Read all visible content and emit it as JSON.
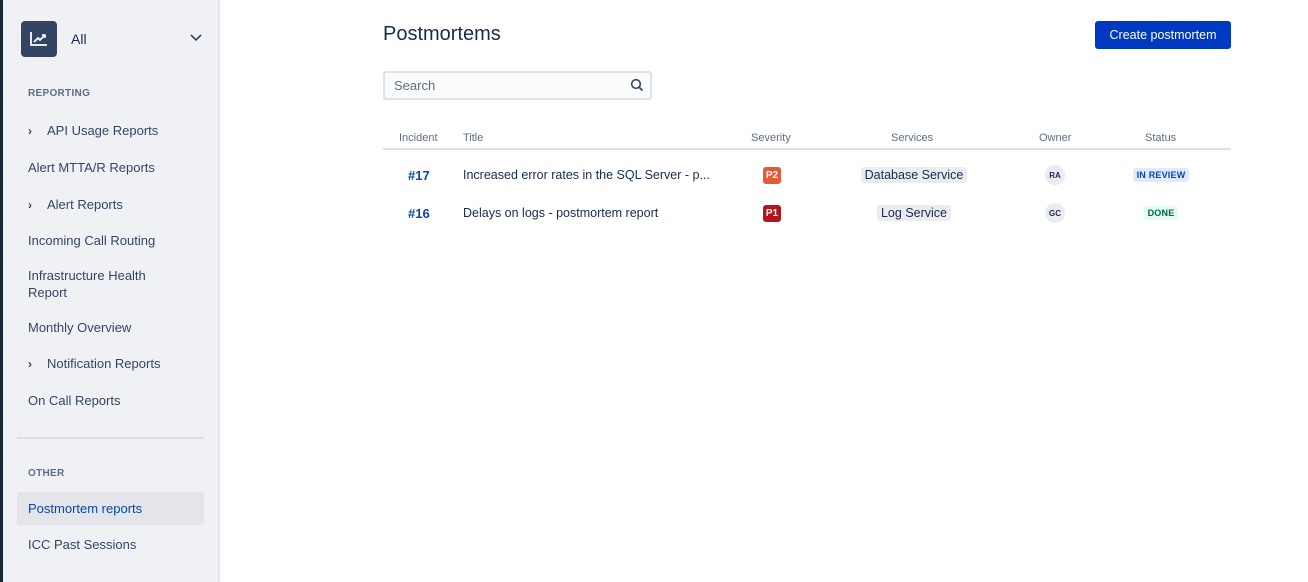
{
  "sidebar": {
    "project": {
      "label": "All",
      "icon": "chart-trend-icon"
    },
    "sections": [
      {
        "label": "REPORTING",
        "items": [
          {
            "label": "API Usage Reports",
            "expandable": true
          },
          {
            "label": "Alert MTTA/R Reports",
            "expandable": false
          },
          {
            "label": "Alert Reports",
            "expandable": true
          },
          {
            "label": "Incoming Call Routing",
            "expandable": false
          },
          {
            "label": "Infrastructure Health Report",
            "expandable": false
          },
          {
            "label": "Monthly Overview",
            "expandable": false
          },
          {
            "label": "Notification Reports",
            "expandable": true
          },
          {
            "label": "On Call Reports",
            "expandable": false
          }
        ]
      },
      {
        "label": "OTHER",
        "items": [
          {
            "label": "Postmortem reports",
            "active": true
          },
          {
            "label": "ICC Past Sessions",
            "active": false
          }
        ]
      }
    ]
  },
  "header": {
    "title": "Postmortems",
    "create_label": "Create postmortem",
    "search_placeholder": "Search"
  },
  "table": {
    "columns": [
      "Incident",
      "Title",
      "Severity",
      "Services",
      "Owner",
      "Status"
    ],
    "rows": [
      {
        "incident": "#17",
        "title": "Increased error rates in the SQL Server - p...",
        "severity": "P2",
        "severity_color": "#e8593a",
        "service": "Database Service",
        "owner": "RA",
        "status": "IN REVIEW",
        "status_bg": "#deebff",
        "status_color": "#0747a6"
      },
      {
        "incident": "#16",
        "title": "Delays on logs - postmortem report",
        "severity": "P1",
        "severity_color": "#b3141e",
        "service": "Log Service",
        "owner": "GC",
        "status": "DONE",
        "status_bg": "#e3fcef",
        "status_color": "#006644"
      }
    ]
  }
}
